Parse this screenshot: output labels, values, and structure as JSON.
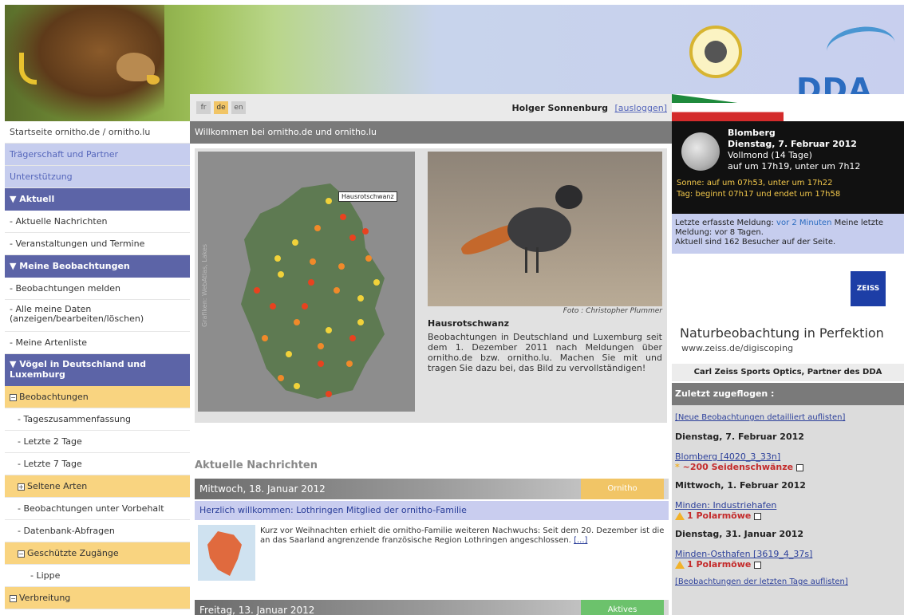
{
  "header": {},
  "sidebar": {
    "items": [
      {
        "label": "Startseite ornitho.de / ornitho.lu"
      },
      {
        "label": "Trägerschaft und Partner"
      },
      {
        "label": "Unterstützung"
      },
      {
        "label": "Aktuell"
      },
      {
        "label": "- Aktuelle Nachrichten"
      },
      {
        "label": "- Veranstaltungen und Termine"
      },
      {
        "label": "Meine Beobachtungen"
      },
      {
        "label": "- Beobachtungen melden"
      },
      {
        "label": "- Alle meine Daten (anzeigen/bearbeiten/löschen)"
      },
      {
        "label": "- Meine Artenliste"
      },
      {
        "label": "Vögel in Deutschland und Luxemburg"
      },
      {
        "label": "Beobachtungen"
      },
      {
        "label": "- Tageszusammenfassung"
      },
      {
        "label": "- Letzte 2 Tage"
      },
      {
        "label": "- Letzte 7 Tage"
      },
      {
        "label": "Seltene Arten"
      },
      {
        "label": "- Beobachtungen unter Vorbehalt"
      },
      {
        "label": "- Datenbank-Abfragen"
      },
      {
        "label": "Geschützte Zugänge"
      },
      {
        "label": "- Lippe"
      },
      {
        "label": "Verbreitung"
      }
    ]
  },
  "topbar": {
    "langs": [
      "fr",
      "de",
      "en"
    ],
    "user_name": "Holger Sonnenburg",
    "logout": "[ausloggen]"
  },
  "welcome": "Willkommen bei ornitho.de und ornitho.lu",
  "feature": {
    "map_label": "Hausrotschwanz",
    "map_credit": "Grafiken: WebAtlas, Lakes",
    "photo_credit": "Foto : Christopher Plummer",
    "title": "Hausrotschwanz",
    "text": "Beobachtungen in Deutschland und Luxemburg seit dem 1. Dezember 2011 nach Meldungen über ornitho.de bzw. ornitho.lu. Machen Sie mit und tragen Sie dazu bei, das Bild zu vervollständigen!"
  },
  "news": {
    "heading": "Aktuelle Nachrichten",
    "items": [
      {
        "date": "Mittwoch, 18. Januar 2012",
        "tag": "Ornitho",
        "tag_color": "#f1c566",
        "title": "Herzlich willkommen: Lothringen Mitglied der ornitho-Familie",
        "text": "Kurz vor Weihnachten erhielt die ornitho-Familie weiteren Nachwuchs: Seit dem 20. Dezember ist die an das Saarland angrenzende französische Region Lothringen angeschlossen.",
        "more": "[...]"
      },
      {
        "date": "Freitag, 13. Januar 2012",
        "tag": "Aktives",
        "tag_color": "#6cc26c"
      }
    ]
  },
  "right": {
    "astro": {
      "location": "Blomberg",
      "date": "Dienstag, 7. Februar 2012",
      "moon_phase": "Vollmond (14 Tage)",
      "moon_times": "auf um 17h19, unter um 7h12",
      "sun": "Sonne: auf um 07h53, unter um 17h22",
      "day": "Tag: beginnt 07h17 und endet um 17h58"
    },
    "status": {
      "prefix": "Letzte erfasste Meldung:",
      "last": "vor 2 Minuten",
      "mine": "Meine letzte Meldung: vor 8 Tagen.",
      "visitors": "Aktuell sind 162 Besucher auf der Seite."
    },
    "sponsor": {
      "logo": "ZEISS",
      "tagline": "Naturbeobachtung in Perfektion",
      "url": "www.zeiss.de/digiscoping",
      "partner": "Carl Zeiss Sports Optics, Partner des DDA"
    },
    "zugeflogen": "Zuletzt zugeflogen :",
    "list": {
      "link_top": "[Neue Beobachtungen detailliert auflisten]",
      "entries": [
        {
          "date": "Dienstag, 7. Februar 2012",
          "place": "Blomberg [4020_3_33n]",
          "count": "~200 Seidenschwänze"
        },
        {
          "date": "Mittwoch, 1. Februar 2012",
          "place": "Minden: Industriehafen",
          "count": "1 Polarmöwe"
        },
        {
          "date": "Dienstag, 31. Januar 2012",
          "place": "Minden-Osthafen [3619_4_37s]",
          "count": "1 Polarmöwe"
        }
      ],
      "link_bottom": "[Beobachtungen der letzten Tage auflisten]"
    }
  }
}
